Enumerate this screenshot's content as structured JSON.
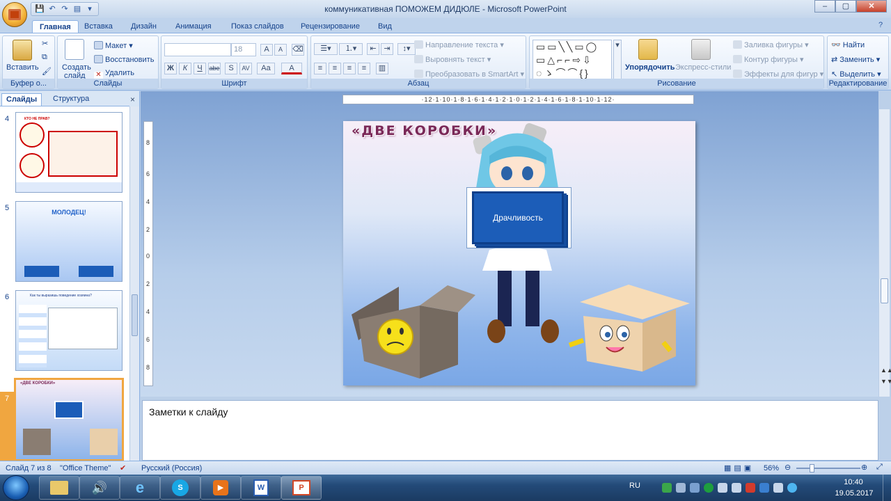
{
  "window": {
    "title": "коммуникативная ПОМОЖЕМ ДИДЮЛЕ - Microsoft PowerPoint",
    "min": "–",
    "max": "▢",
    "close": "✕"
  },
  "qat": [
    "💾",
    "↶",
    "↷",
    "▤",
    "▾"
  ],
  "tabs": [
    "Главная",
    "Вставка",
    "Дизайн",
    "Анимация",
    "Показ слайдов",
    "Рецензирование",
    "Вид"
  ],
  "ribbon": {
    "clipboard": {
      "paste": "Вставить",
      "label": "Буфер о..."
    },
    "slides": {
      "new_slide": "Создать",
      "new_slide2": "слайд",
      "layout": "Макет",
      "reset": "Восстановить",
      "delete": "Удалить",
      "label": "Слайды"
    },
    "font": {
      "font_name": "",
      "size": "18",
      "grow": "A",
      "shrink": "A",
      "bold": "Ж",
      "italic": "К",
      "underline": "Ч",
      "strike": "abe",
      "shadow": "S",
      "spacing": "AV",
      "case": "Aa",
      "color": "A",
      "label": "Шрифт"
    },
    "paragraph": {
      "direction": "Направление текста",
      "align": "Выровнять текст",
      "smartart": "Преобразовать в SmartArt",
      "label": "Абзац"
    },
    "drawing": {
      "arrange": "Упорядочить",
      "quick_styles": "Экспресс-стили",
      "fill": "Заливка фигуры",
      "outline": "Контур фигуры",
      "effects": "Эффекты для фигур",
      "label": "Рисование"
    },
    "editing": {
      "find": "Найти",
      "replace": "Заменить",
      "select": "Выделить",
      "label": "Редактирование"
    }
  },
  "panel": {
    "tab_slides": "Слайды",
    "tab_outline": "Структура",
    "close": "×",
    "thumbs": [
      {
        "num": "4",
        "title": "КТО НЕ ПРАВ?"
      },
      {
        "num": "5",
        "title": "МОЛОДЕЦ!"
      },
      {
        "num": "6",
        "title": "Как ты выразишь поведение хозяина?"
      },
      {
        "num": "7",
        "title": "«ДВЕ КОРОБКИ»"
      }
    ]
  },
  "slide": {
    "title": "«ДВЕ КОРОБКИ»",
    "card_text": "Драчливость"
  },
  "ruler": {
    "h": "·12·1·10·1·8·1·6·1·4·1·2·1·0·1·2·1·4·1·6·1·8·1·10·1·12·",
    "v": [
      "8",
      "6",
      "4",
      "2",
      "0",
      "2",
      "4",
      "6",
      "8"
    ]
  },
  "notes": {
    "placeholder": "Заметки к слайду"
  },
  "status": {
    "slide_info": "Слайд 7 из 8",
    "theme": "\"Office Theme\"",
    "language": "Русский (Россия)",
    "zoom": "56%"
  },
  "taskbar": {
    "lang": "RU",
    "time": "10:40",
    "date": "19.05.2017"
  }
}
